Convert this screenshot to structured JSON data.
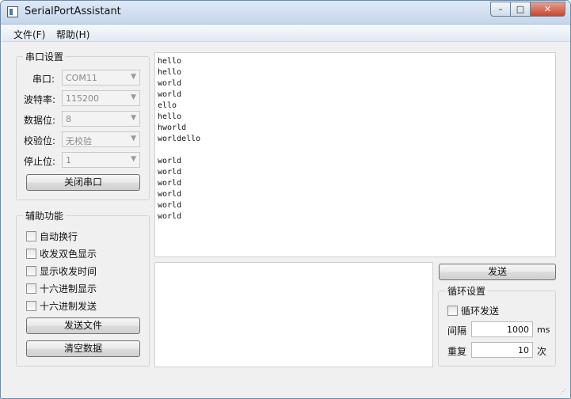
{
  "window": {
    "title": "SerialPortAssistant"
  },
  "menu": {
    "file": "文件(F)",
    "help": "帮助(H)"
  },
  "serial_settings": {
    "title": "串口设置",
    "port_label": "串口:",
    "port_value": "COM11",
    "baud_label": "波特率:",
    "baud_value": "115200",
    "databits_label": "数据位:",
    "databits_value": "8",
    "parity_label": "校验位:",
    "parity_value": "无校验",
    "stopbits_label": "停止位:",
    "stopbits_value": "1",
    "toggle_button": "关闭串口"
  },
  "aux": {
    "title": "辅助功能",
    "auto_wrap": "自动换行",
    "dual_color": "收发双色显示",
    "show_time": "显示收发时间",
    "hex_display": "十六进制显示",
    "hex_send": "十六进制发送",
    "send_file": "发送文件",
    "clear_data": "清空数据"
  },
  "receive": {
    "text": "hello\nhello\nworld\nworld\nello\nhello\nhworld\nworldello\n\nworld\nworld\nworld\nworld\nworld\nworld"
  },
  "send": {
    "button": "发送"
  },
  "loop": {
    "title": "循环设置",
    "loop_send": "循环发送",
    "interval_label": "间隔",
    "interval_value": "1000",
    "interval_unit": "ms",
    "repeat_label": "重复",
    "repeat_value": "10",
    "repeat_unit": "次"
  }
}
